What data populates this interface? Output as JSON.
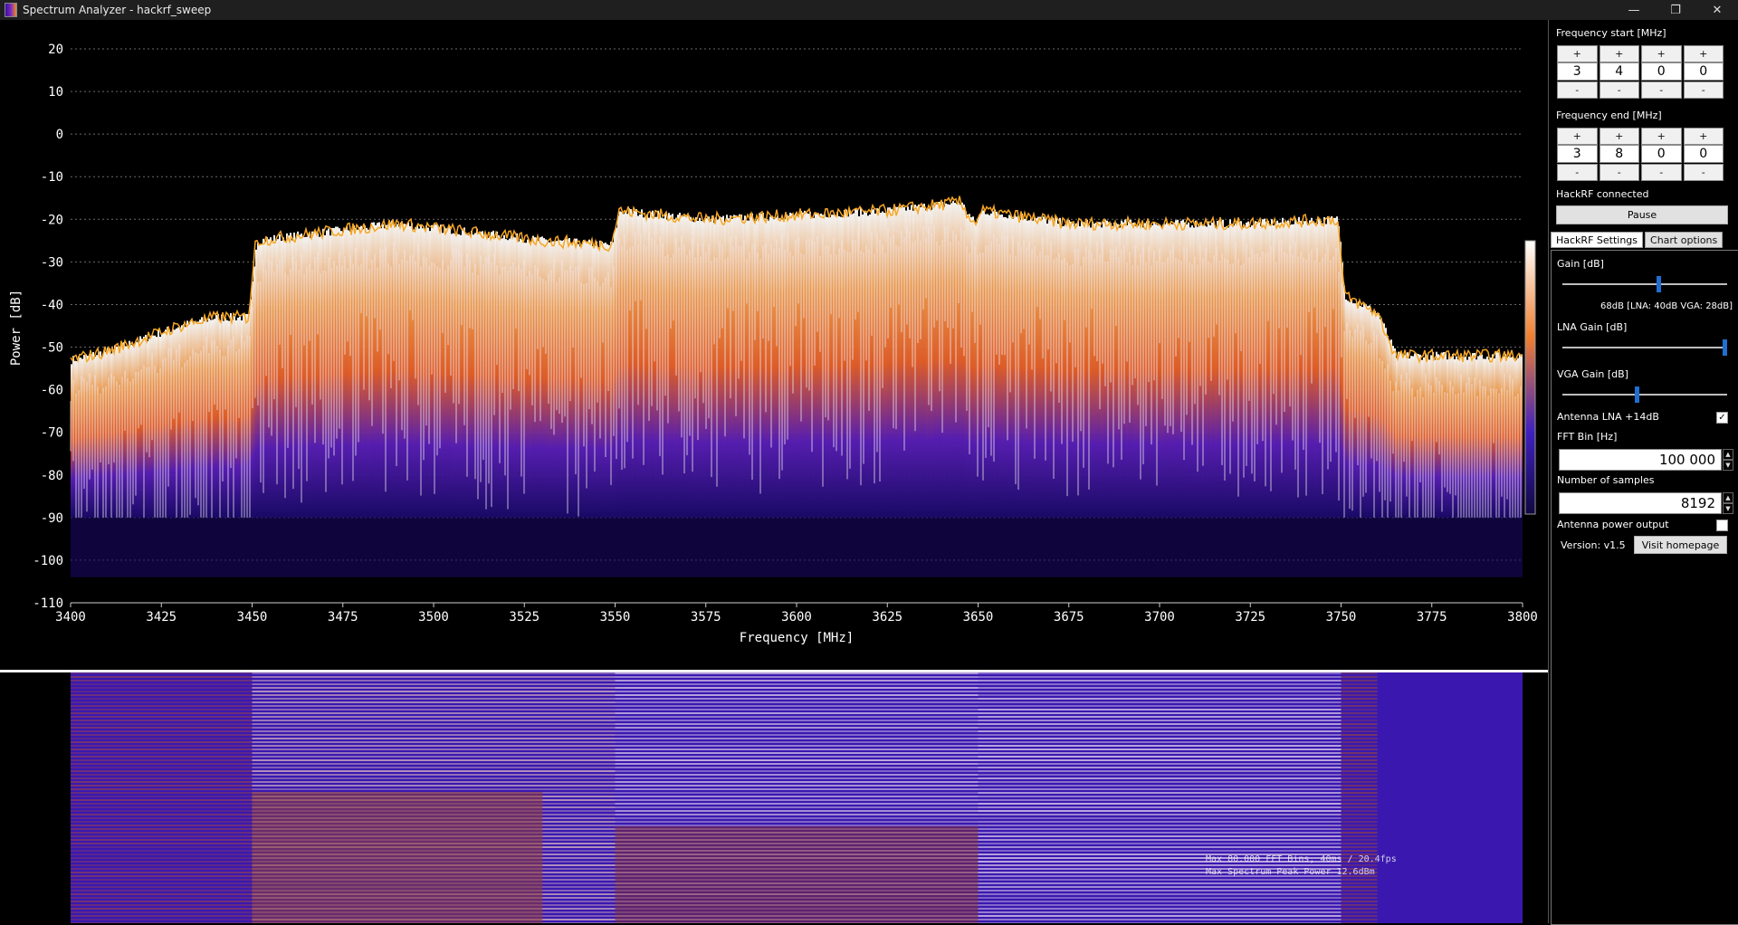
{
  "window": {
    "title": "Spectrum Analyzer - hackrf_sweep",
    "controls": {
      "minimize": "—",
      "restore": "❐",
      "close": "✕"
    }
  },
  "chart_data": {
    "type": "area",
    "xlabel": "Frequency [MHz]",
    "ylabel": "Power [dB]",
    "xlim": [
      3400,
      3800
    ],
    "ylim": [
      -110,
      25
    ],
    "xticks": [
      3400,
      3425,
      3450,
      3475,
      3500,
      3525,
      3550,
      3575,
      3600,
      3625,
      3650,
      3675,
      3700,
      3725,
      3750,
      3775,
      3800
    ],
    "yticks": [
      20,
      10,
      0,
      -10,
      -20,
      -30,
      -40,
      -50,
      -60,
      -70,
      -80,
      -90,
      -100,
      -110
    ],
    "grid": true,
    "colors": {
      "trace": "#f6a623",
      "heat_high": "#ffffff",
      "heat_mid": "#f0752a",
      "heat_low": "#3a1cc4",
      "background": "#000000"
    },
    "series": [
      {
        "peak_trace": {
          "x": [
            3400,
            3410,
            3420,
            3430,
            3440,
            3449,
            3451,
            3470,
            3490,
            3510,
            3530,
            3549,
            3551,
            3575,
            3600,
            3625,
            3645,
            3649,
            3651,
            3675,
            3700,
            3725,
            3749,
            3751,
            3760,
            3765,
            3780,
            3800
          ],
          "y": [
            -53,
            -51,
            -48,
            -45,
            -43,
            -43,
            -25,
            -23,
            -21,
            -23,
            -25,
            -26,
            -18,
            -20,
            -19,
            -18,
            -16,
            -21,
            -18,
            -21,
            -21,
            -21,
            -20,
            -38,
            -42,
            -52,
            -52,
            -52
          ]
        }
      }
    ]
  },
  "waterfall": {
    "overlay_line1": "Max 80.000 FFT Bins, 40ms / 20.4fps",
    "overlay_line2": "Max Spectrum Peak Power 12.6dBm"
  },
  "panel": {
    "freq_start_label": "Frequency start [MHz]",
    "freq_start_digits": [
      "3",
      "4",
      "0",
      "0"
    ],
    "freq_end_label": "Frequency end [MHz]",
    "freq_end_digits": [
      "3",
      "8",
      "0",
      "0"
    ],
    "plus": "+",
    "minus": "-",
    "status": "HackRF connected",
    "pause_label": "Pause",
    "tabs": [
      "HackRF Settings",
      "Chart options"
    ],
    "gain_label": "Gain [dB]",
    "gain_value": 68,
    "gain_summary": "68dB [LNA: 40dB  VGA: 28dB]",
    "lna_label": "LNA Gain [dB]",
    "lna_value": 40,
    "vga_label": "VGA Gain [dB]",
    "vga_value": 28,
    "antenna_lna_label": "Antenna LNA +14dB",
    "antenna_lna_checked": "✓",
    "fft_bin_label": "FFT Bin [Hz]",
    "fft_bin_value": "100 000",
    "samples_label": "Number of samples",
    "samples_value": "8192",
    "antenna_power_label": "Antenna power output",
    "version": "Version: v1.5",
    "homepage_label": "Visit homepage"
  }
}
